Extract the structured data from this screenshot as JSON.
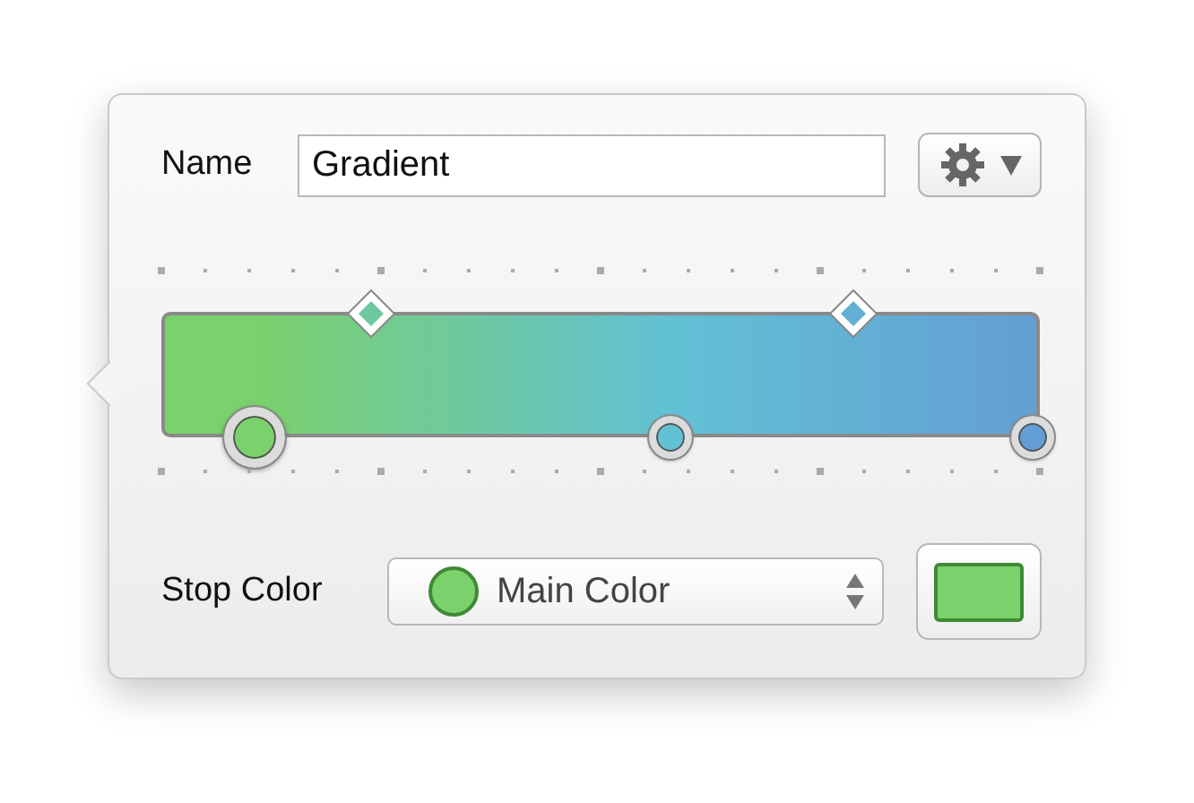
{
  "name_field": {
    "label": "Name",
    "value": "Gradient"
  },
  "gradient": {
    "stops": [
      {
        "level": 0.102,
        "color": "#7bd16b",
        "selected": true
      },
      {
        "level": 0.58,
        "color": "#62c1d4",
        "selected": false
      },
      {
        "level": 0.996,
        "color": "#639fd4",
        "selected": false
      }
    ],
    "midpoints": [
      {
        "level": 0.237
      },
      {
        "level": 0.79
      }
    ]
  },
  "stop_color": {
    "label": "Stop Color",
    "value": "Main Color",
    "color": "#7bd16b"
  }
}
